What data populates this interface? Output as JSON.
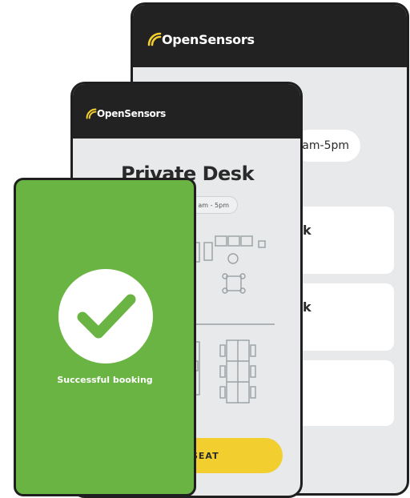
{
  "brand": {
    "name": "OpenSensors",
    "icon": "wifi-signal-icon",
    "header_color": "#222223",
    "accent_yellow": "#f2cf2e",
    "success_green": "#6ab443"
  },
  "back_screen": {
    "time_pill": "am-5pm",
    "cards": [
      {
        "label": "k"
      },
      {
        "label": "k"
      },
      {
        "label": ""
      }
    ]
  },
  "middle_screen": {
    "title": "Private Desk",
    "time_pill": "am - 5pm",
    "seat_button_label": "SEAT"
  },
  "front_screen": {
    "status_icon": "checkmark-icon",
    "message": "Successful booking"
  }
}
